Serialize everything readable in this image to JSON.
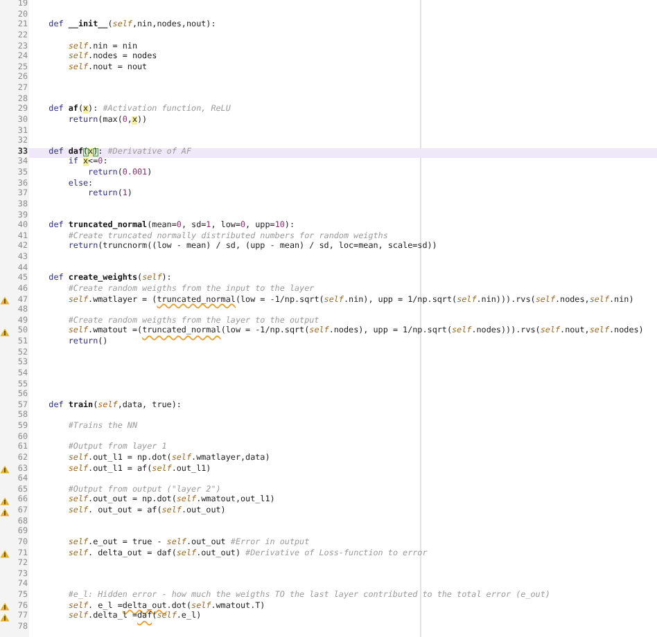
{
  "editor": {
    "lines": [
      {
        "number": "19",
        "current": false,
        "warning": false
      },
      {
        "number": "20",
        "current": false,
        "warning": false
      },
      {
        "number": "21",
        "current": false,
        "warning": false,
        "tokens": [
          {
            "kind": "keyword",
            "text": "def "
          },
          {
            "kind": "function",
            "text": "__init__"
          },
          {
            "kind": "plain",
            "text": "("
          },
          {
            "kind": "self",
            "text": "self"
          },
          {
            "kind": "plain",
            "text": ",nin,nodes,nout):"
          }
        ],
        "children": [
          {
            "number": "22",
            "current": false,
            "warning": false
          },
          {
            "number": "23",
            "current": false,
            "warning": false,
            "tokens": [
              {
                "kind": "self",
                "text": "self"
              },
              {
                "kind": "plain",
                "text": ".nin = nin"
              }
            ]
          },
          {
            "number": "24",
            "current": false,
            "warning": false,
            "tokens": [
              {
                "kind": "self",
                "text": "self"
              },
              {
                "kind": "plain",
                "text": ".nodes = nodes"
              }
            ]
          },
          {
            "number": "25",
            "current": false,
            "warning": false,
            "tokens": [
              {
                "kind": "self",
                "text": "self"
              },
              {
                "kind": "plain",
                "text": ".nout = nout"
              }
            ]
          }
        ]
      },
      {
        "number": "26",
        "current": false,
        "warning": false
      },
      {
        "number": "27",
        "current": false,
        "warning": false
      },
      {
        "number": "28",
        "current": false,
        "warning": false
      },
      {
        "number": "29",
        "current": false,
        "warning": false,
        "tokens": [
          {
            "kind": "keyword",
            "text": "def "
          },
          {
            "kind": "function",
            "text": "af"
          },
          {
            "kind": "plain",
            "text": "("
          },
          {
            "kind": "occurrence",
            "text": "x"
          },
          {
            "kind": "plain",
            "text": "): "
          },
          {
            "kind": "comment",
            "text": "#Activation function, ReLU"
          }
        ],
        "children": [
          {
            "number": "30",
            "current": false,
            "warning": false,
            "tokens": [
              {
                "kind": "keyword",
                "text": "return"
              },
              {
                "kind": "plain",
                "text": "(max("
              },
              {
                "kind": "number",
                "text": "0"
              },
              {
                "kind": "plain",
                "text": ","
              },
              {
                "kind": "occurrence",
                "text": "x"
              },
              {
                "kind": "plain",
                "text": "))"
              }
            ]
          }
        ]
      },
      {
        "number": "31",
        "current": false,
        "warning": false
      },
      {
        "number": "32",
        "current": false,
        "warning": false
      },
      {
        "number": "33",
        "current": true,
        "warning": false,
        "tokens": [
          {
            "kind": "keyword",
            "text": "def "
          },
          {
            "kind": "function",
            "text": "daf"
          },
          {
            "kind": "bracket",
            "text": "("
          },
          {
            "kind": "occurrence",
            "text": "x"
          },
          {
            "kind": "bracket",
            "text": ")"
          },
          {
            "kind": "plain",
            "text": ": "
          },
          {
            "kind": "comment",
            "text": "#Derivative of AF"
          }
        ],
        "children": [
          {
            "number": "34",
            "current": false,
            "warning": false,
            "tokens": [
              {
                "kind": "keyword",
                "text": "if "
              },
              {
                "kind": "occurrence",
                "text": "x"
              },
              {
                "kind": "plain",
                "text": "<="
              },
              {
                "kind": "number",
                "text": "0"
              },
              {
                "kind": "plain",
                "text": ":"
              }
            ],
            "children": [
              {
                "number": "35",
                "current": false,
                "warning": false,
                "tokens": [
                  {
                    "kind": "keyword",
                    "text": "return"
                  },
                  {
                    "kind": "plain",
                    "text": "("
                  },
                  {
                    "kind": "number",
                    "text": "0.001"
                  },
                  {
                    "kind": "plain",
                    "text": ")"
                  }
                ]
              }
            ]
          },
          {
            "number": "36",
            "current": false,
            "warning": false,
            "tokens": [
              {
                "kind": "keyword",
                "text": "else"
              },
              {
                "kind": "plain",
                "text": ":"
              }
            ],
            "children": [
              {
                "number": "37",
                "current": false,
                "warning": false,
                "tokens": [
                  {
                    "kind": "keyword",
                    "text": "return"
                  },
                  {
                    "kind": "plain",
                    "text": "("
                  },
                  {
                    "kind": "number",
                    "text": "1"
                  },
                  {
                    "kind": "plain",
                    "text": ")"
                  }
                ]
              }
            ]
          }
        ]
      },
      {
        "number": "38",
        "current": false,
        "warning": false
      },
      {
        "number": "39",
        "current": false,
        "warning": false
      },
      {
        "number": "40",
        "current": false,
        "warning": false,
        "tokens": [
          {
            "kind": "keyword",
            "text": "def "
          },
          {
            "kind": "function",
            "text": "truncated_normal"
          },
          {
            "kind": "plain",
            "text": "(mean="
          },
          {
            "kind": "number",
            "text": "0"
          },
          {
            "kind": "plain",
            "text": ", sd="
          },
          {
            "kind": "number",
            "text": "1"
          },
          {
            "kind": "plain",
            "text": ", low="
          },
          {
            "kind": "number",
            "text": "0"
          },
          {
            "kind": "plain",
            "text": ", upp="
          },
          {
            "kind": "number",
            "text": "10"
          },
          {
            "kind": "plain",
            "text": "):"
          }
        ],
        "children": [
          {
            "number": "41",
            "current": false,
            "warning": false,
            "tokens": [
              {
                "kind": "comment",
                "text": "#Create truncated normally distributed numbers for random weigths"
              }
            ]
          },
          {
            "number": "42",
            "current": false,
            "warning": false,
            "tokens": [
              {
                "kind": "keyword",
                "text": "return"
              },
              {
                "kind": "plain",
                "text": "(truncnorm((low - mean) / sd, (upp - mean) / sd, loc=mean, scale=sd))"
              }
            ]
          }
        ]
      },
      {
        "number": "43",
        "current": false,
        "warning": false
      },
      {
        "number": "44",
        "current": false,
        "warning": false
      },
      {
        "number": "45",
        "current": false,
        "warning": false,
        "tokens": [
          {
            "kind": "keyword",
            "text": "def "
          },
          {
            "kind": "function",
            "text": "create_weights"
          },
          {
            "kind": "plain",
            "text": "("
          },
          {
            "kind": "self",
            "text": "self"
          },
          {
            "kind": "plain",
            "text": "):"
          }
        ],
        "children": [
          {
            "number": "46",
            "current": false,
            "warning": false,
            "tokens": [
              {
                "kind": "comment",
                "text": "#Create random weigths from the input to the layer"
              }
            ]
          },
          {
            "number": "47",
            "current": false,
            "warning": true,
            "tokens": [
              {
                "kind": "self",
                "text": "self"
              },
              {
                "kind": "plain",
                "text": ".wmatlayer = ("
              },
              {
                "kind": "flagged",
                "text": "truncated_normal"
              },
              {
                "kind": "plain",
                "text": "(low = -1/np.sqrt("
              },
              {
                "kind": "self",
                "text": "self"
              },
              {
                "kind": "plain",
                "text": ".nin), upp = 1/np.sqrt("
              },
              {
                "kind": "self",
                "text": "self"
              },
              {
                "kind": "plain",
                "text": ".nin))).rvs("
              },
              {
                "kind": "self",
                "text": "self"
              },
              {
                "kind": "plain",
                "text": ".nodes,"
              },
              {
                "kind": "self",
                "text": "self"
              },
              {
                "kind": "plain",
                "text": ".nin)"
              }
            ]
          },
          {
            "number": "48",
            "current": false,
            "warning": false
          },
          {
            "number": "49",
            "current": false,
            "warning": false,
            "tokens": [
              {
                "kind": "comment",
                "text": "#Create random weigths from the layer to the output"
              }
            ]
          },
          {
            "number": "50",
            "current": false,
            "warning": true,
            "tokens": [
              {
                "kind": "self",
                "text": "self"
              },
              {
                "kind": "plain",
                "text": ".wmatout =("
              },
              {
                "kind": "flagged",
                "text": "truncated_normal"
              },
              {
                "kind": "plain",
                "text": "(low = -1/np.sqrt("
              },
              {
                "kind": "self",
                "text": "self"
              },
              {
                "kind": "plain",
                "text": ".nodes), upp = 1/np.sqrt("
              },
              {
                "kind": "self",
                "text": "self"
              },
              {
                "kind": "plain",
                "text": ".nodes))).rvs("
              },
              {
                "kind": "self",
                "text": "self"
              },
              {
                "kind": "plain",
                "text": ".nout,"
              },
              {
                "kind": "self",
                "text": "self"
              },
              {
                "kind": "plain",
                "text": ".nodes)"
              }
            ]
          },
          {
            "number": "51",
            "current": false,
            "warning": false,
            "tokens": [
              {
                "kind": "keyword",
                "text": "return"
              },
              {
                "kind": "plain",
                "text": "()"
              }
            ]
          }
        ]
      },
      {
        "number": "52",
        "current": false,
        "warning": false
      },
      {
        "number": "53",
        "current": false,
        "warning": false
      },
      {
        "number": "54",
        "current": false,
        "warning": false
      },
      {
        "number": "55",
        "current": false,
        "warning": false
      },
      {
        "number": "56",
        "current": false,
        "warning": false
      },
      {
        "number": "57",
        "current": false,
        "warning": false,
        "tokens": [
          {
            "kind": "keyword",
            "text": "def "
          },
          {
            "kind": "function",
            "text": "train"
          },
          {
            "kind": "plain",
            "text": "("
          },
          {
            "kind": "self",
            "text": "self"
          },
          {
            "kind": "plain",
            "text": ",data, true):"
          }
        ],
        "children": [
          {
            "number": "58",
            "current": false,
            "warning": false
          },
          {
            "number": "59",
            "current": false,
            "warning": false,
            "tokens": [
              {
                "kind": "comment",
                "text": "#Trains the NN"
              }
            ]
          },
          {
            "number": "60",
            "current": false,
            "warning": false
          },
          {
            "number": "61",
            "current": false,
            "warning": false,
            "tokens": [
              {
                "kind": "comment",
                "text": "#Output from layer 1"
              }
            ]
          },
          {
            "number": "62",
            "current": false,
            "warning": false,
            "tokens": [
              {
                "kind": "self",
                "text": "self"
              },
              {
                "kind": "plain",
                "text": ".out_l1 = np.dot("
              },
              {
                "kind": "self",
                "text": "self"
              },
              {
                "kind": "plain",
                "text": ".wmatlayer,data)"
              }
            ]
          },
          {
            "number": "63",
            "current": false,
            "warning": true,
            "tokens": [
              {
                "kind": "self",
                "text": "self"
              },
              {
                "kind": "plain",
                "text": ".out_l1 = af("
              },
              {
                "kind": "self",
                "text": "self"
              },
              {
                "kind": "plain",
                "text": ".out_l1)"
              }
            ]
          },
          {
            "number": "64",
            "current": false,
            "warning": false
          },
          {
            "number": "65",
            "current": false,
            "warning": false,
            "tokens": [
              {
                "kind": "comment",
                "text": "#Output from output (\"layer 2\")"
              }
            ]
          },
          {
            "number": "66",
            "current": false,
            "warning": true,
            "tokens": [
              {
                "kind": "self",
                "text": "self"
              },
              {
                "kind": "plain",
                "text": ".out_out = np.dot("
              },
              {
                "kind": "self",
                "text": "self"
              },
              {
                "kind": "plain",
                "text": ".wmatout,out_l1)"
              }
            ]
          },
          {
            "number": "67",
            "current": false,
            "warning": true,
            "tokens": [
              {
                "kind": "self",
                "text": "self"
              },
              {
                "kind": "plain",
                "text": ". out_out = af("
              },
              {
                "kind": "self",
                "text": "self"
              },
              {
                "kind": "plain",
                "text": ".out_out)"
              }
            ]
          },
          {
            "number": "68",
            "current": false,
            "warning": false
          },
          {
            "number": "69",
            "current": false,
            "warning": false
          },
          {
            "number": "70",
            "current": false,
            "warning": false,
            "tokens": [
              {
                "kind": "self",
                "text": "self"
              },
              {
                "kind": "plain",
                "text": ".e_out = true - "
              },
              {
                "kind": "self",
                "text": "self"
              },
              {
                "kind": "plain",
                "text": ".out_out "
              },
              {
                "kind": "comment",
                "text": "#Error in output"
              }
            ]
          },
          {
            "number": "71",
            "current": false,
            "warning": true,
            "tokens": [
              {
                "kind": "self",
                "text": "self"
              },
              {
                "kind": "plain",
                "text": ". delta_out = daf("
              },
              {
                "kind": "self",
                "text": "self"
              },
              {
                "kind": "plain",
                "text": ".out_out) "
              },
              {
                "kind": "comment",
                "text": "#Derivative of Loss-function to error"
              }
            ]
          },
          {
            "number": "72",
            "current": false,
            "warning": false
          },
          {
            "number": "73",
            "current": false,
            "warning": false
          },
          {
            "number": "74",
            "current": false,
            "warning": false
          },
          {
            "number": "75",
            "current": false,
            "warning": false,
            "tokens": [
              {
                "kind": "comment",
                "text": "#e_l: Hidden error - how much the weigths TO the last layer contributed to the total error (e_out)"
              }
            ]
          },
          {
            "number": "76",
            "current": false,
            "warning": true,
            "tokens": [
              {
                "kind": "self",
                "text": "self"
              },
              {
                "kind": "plain",
                "text": ". e_l ="
              },
              {
                "kind": "flagged",
                "text": "delta_out"
              },
              {
                "kind": "plain",
                "text": ".dot("
              },
              {
                "kind": "self",
                "text": "self"
              },
              {
                "kind": "plain",
                "text": ".wmatout.T)"
              }
            ]
          },
          {
            "number": "77",
            "current": false,
            "warning": true,
            "tokens": [
              {
                "kind": "self",
                "text": "self"
              },
              {
                "kind": "plain",
                "text": ".delta_l ="
              },
              {
                "kind": "flagged",
                "text": "daf"
              },
              {
                "kind": "plain",
                "text": "("
              },
              {
                "kind": "self",
                "text": "self"
              },
              {
                "kind": "plain",
                "text": ".e_l)"
              }
            ]
          }
        ]
      },
      {
        "number": "78",
        "current": false,
        "warning": false
      }
    ]
  }
}
